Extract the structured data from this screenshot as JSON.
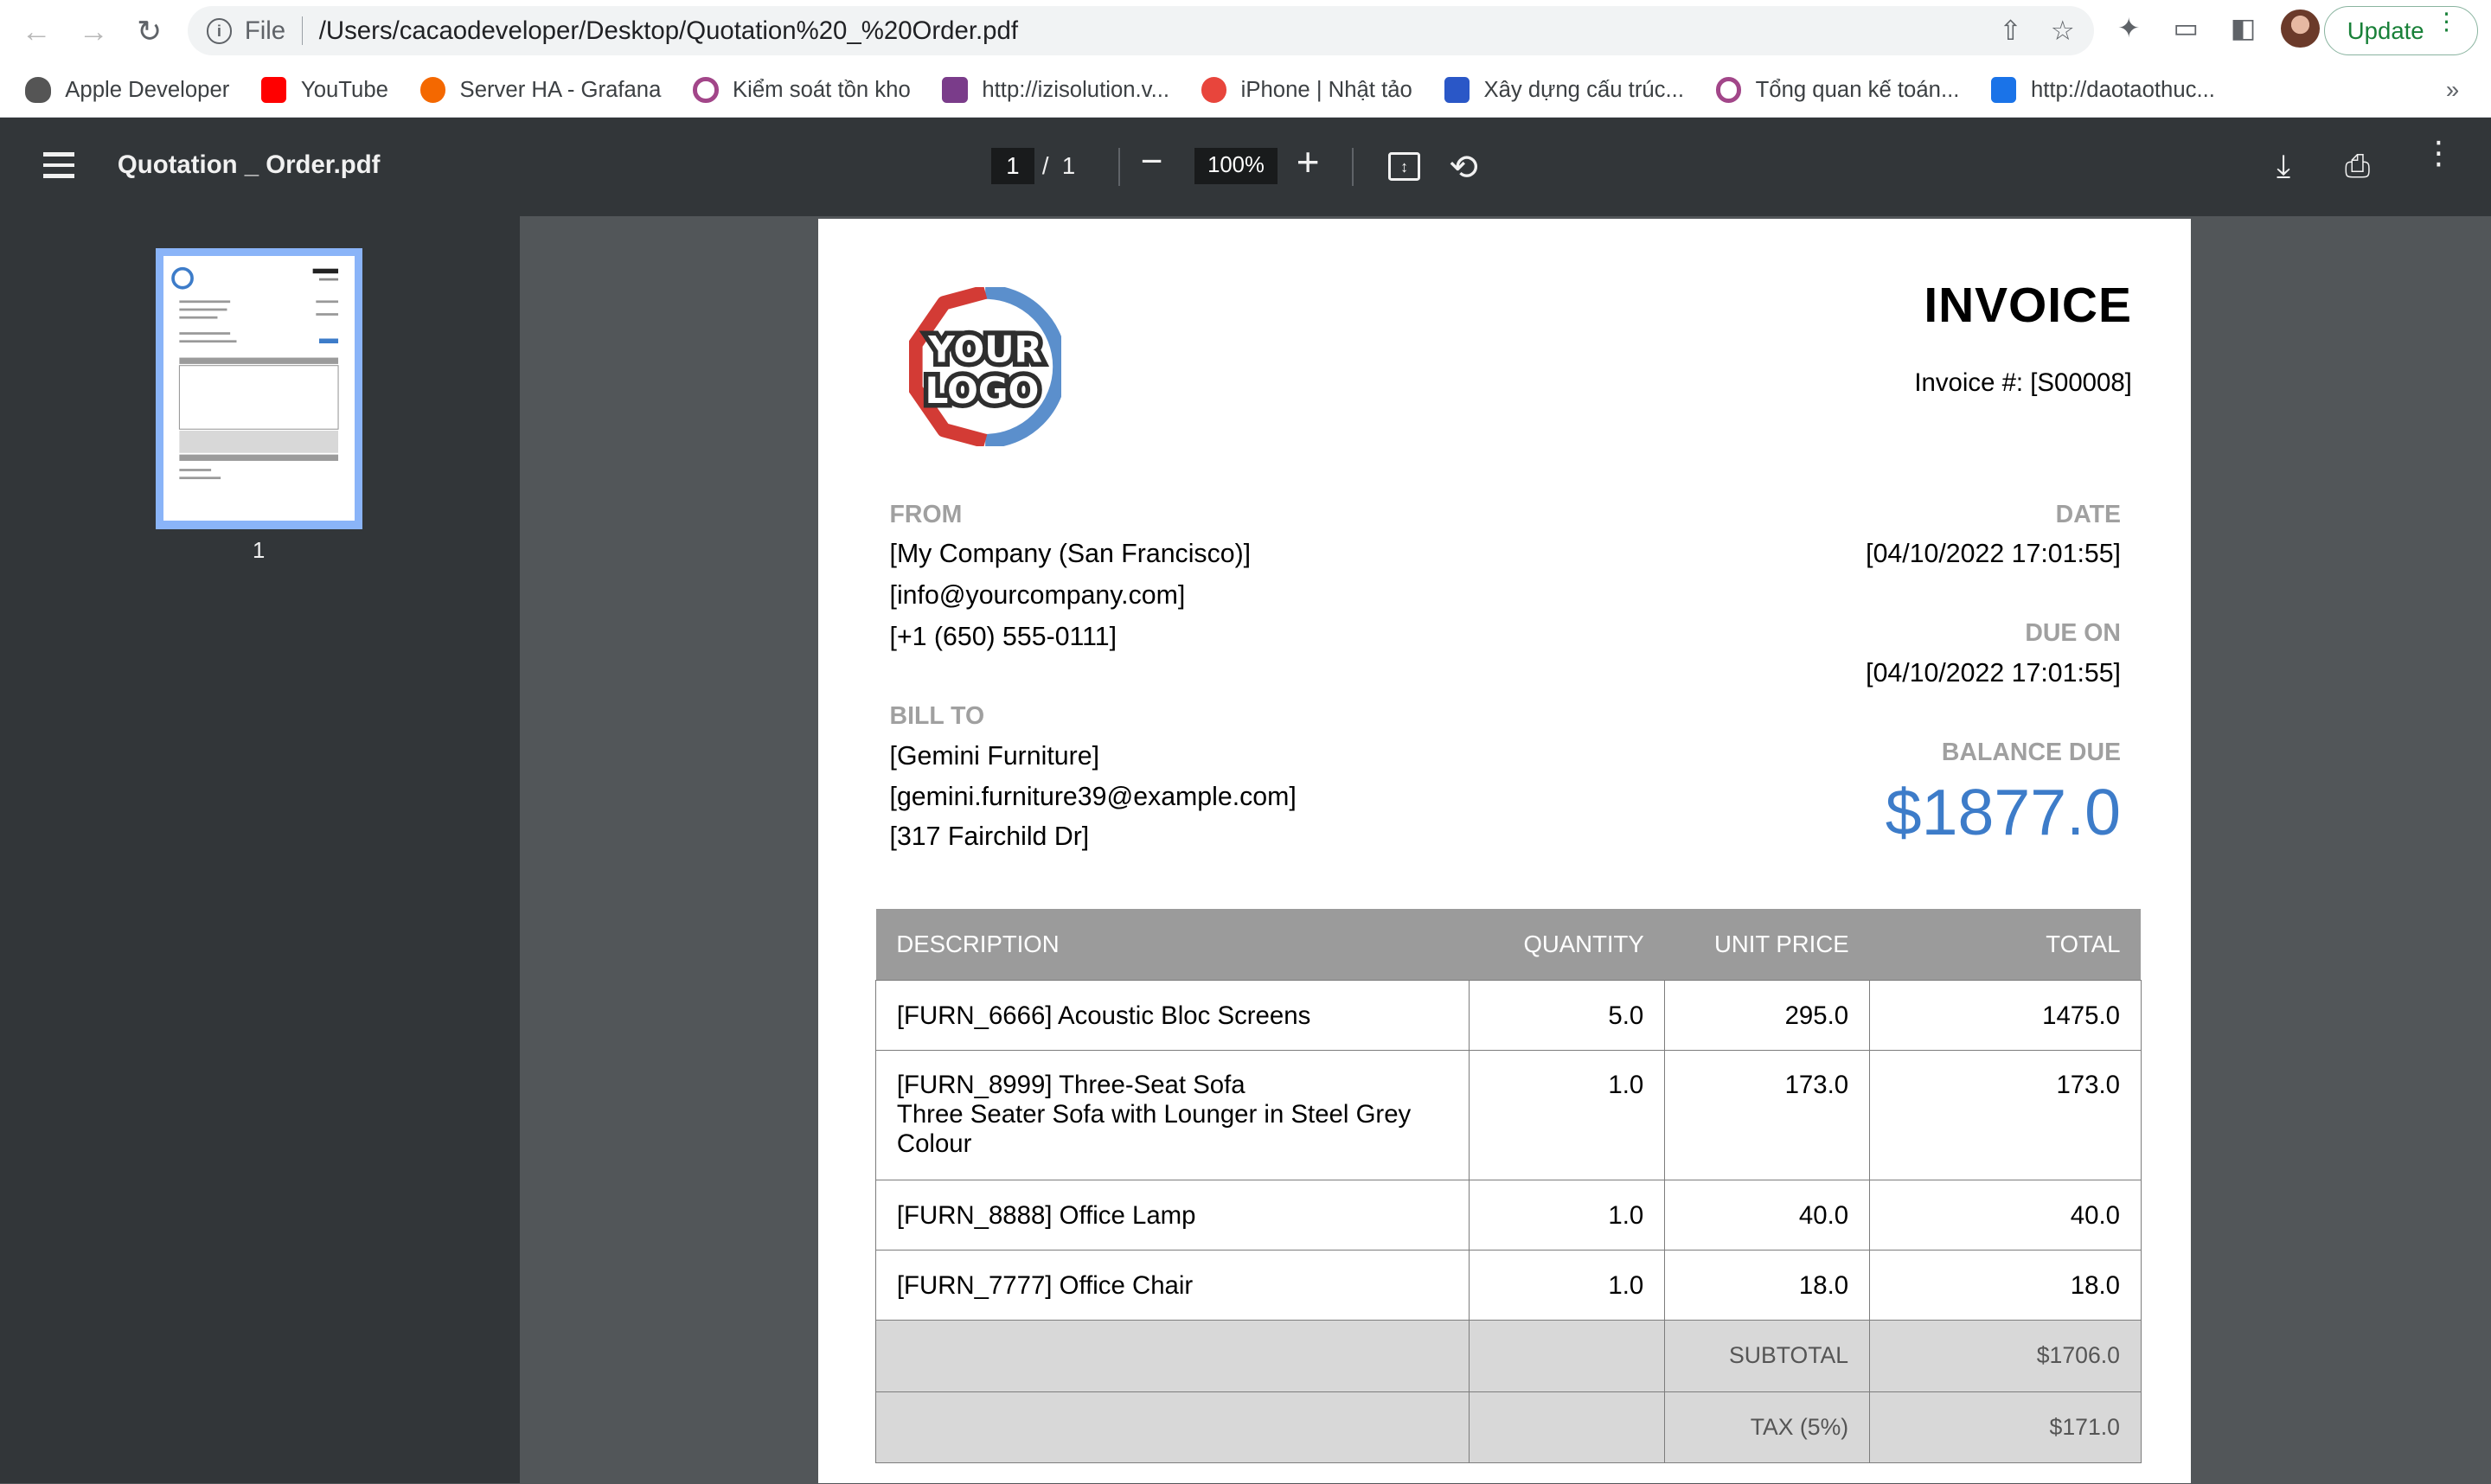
{
  "browser": {
    "scheme": "File",
    "url": "/Users/cacaodeveloper/Desktop/Quotation%20_%20Order.pdf",
    "update_label": "Update"
  },
  "bookmarks": [
    {
      "label": "Apple Developer",
      "color": "#333333"
    },
    {
      "label": "YouTube",
      "color": "#ff0000"
    },
    {
      "label": "Server HA - Grafana",
      "color": "#f46800"
    },
    {
      "label": "Kiểm soát tồn kho",
      "color": "#a24689"
    },
    {
      "label": "http://izisolution.v...",
      "color": "#7a3c8a"
    },
    {
      "label": "iPhone | Nhật tảo",
      "color": "#e8453c"
    },
    {
      "label": "Xây dựng cấu trúc...",
      "color": "#2a57c7"
    },
    {
      "label": "Tổng quan kế toán...",
      "color": "#a24689"
    },
    {
      "label": "http://daotaothuc...",
      "color": "#1a73e8"
    }
  ],
  "viewer": {
    "title": "Quotation _ Order.pdf",
    "current_page": "1",
    "page_sep": "/",
    "total_pages": "1",
    "zoom": "100%",
    "thumb_label": "1"
  },
  "invoice": {
    "logo_line1": "YOUR",
    "logo_line2": "LOGO",
    "title": "INVOICE",
    "number": "Invoice #: [S00008]",
    "from_label": "FROM",
    "from_lines": [
      "[My Company (San Francisco)]",
      "[info@yourcompany.com]",
      "[+1 (650) 555-0111]"
    ],
    "bill_label": "BILL TO",
    "bill_lines": [
      "[Gemini Furniture]",
      "[gemini.furniture39@example.com]",
      "[317 Fairchild Dr]"
    ],
    "date_label": "DATE",
    "date": "[04/10/2022 17:01:55]",
    "due_label": "DUE ON",
    "due": "[04/10/2022 17:01:55]",
    "balance_label": "BALANCE DUE",
    "balance": "$1877.0",
    "accent_color": "#3d7cc9"
  },
  "table": {
    "headers": [
      "DESCRIPTION",
      "QUANTITY",
      "UNIT PRICE",
      "TOTAL"
    ],
    "rows": [
      {
        "desc": "[FURN_6666] Acoustic Bloc Screens",
        "qty": "5.0",
        "price": "295.0",
        "total": "1475.0"
      },
      {
        "desc": "[FURN_8999] Three-Seat Sofa\nThree Seater Sofa with Lounger in Steel Grey Colour",
        "qty": "1.0",
        "price": "173.0",
        "total": "173.0"
      },
      {
        "desc": "[FURN_8888] Office Lamp",
        "qty": "1.0",
        "price": "40.0",
        "total": "40.0"
      },
      {
        "desc": "[FURN_7777] Office Chair",
        "qty": "1.0",
        "price": "18.0",
        "total": "18.0"
      }
    ],
    "subtotal_label": "SUBTOTAL",
    "subtotal": "$1706.0",
    "tax_label": "TAX (5%)",
    "tax": "$171.0"
  }
}
